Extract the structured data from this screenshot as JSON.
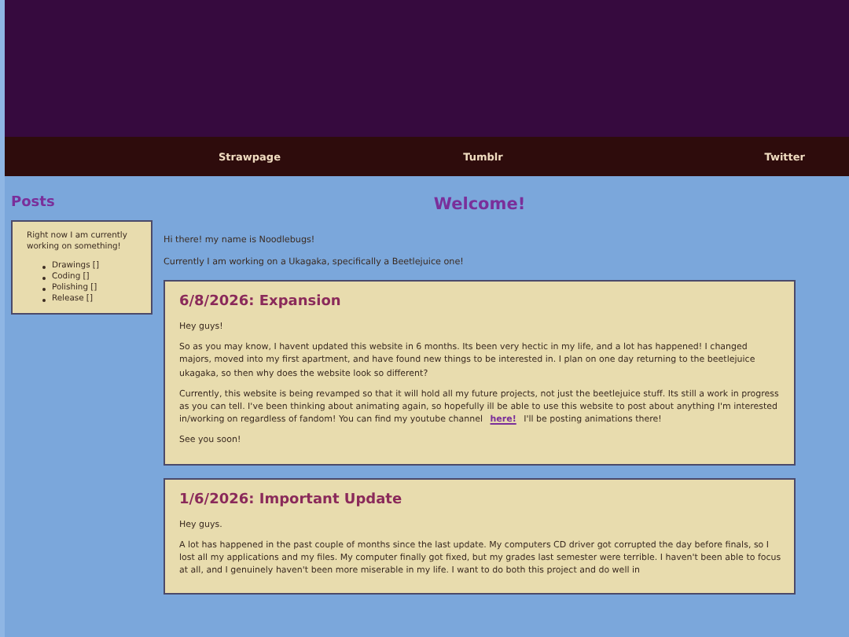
{
  "nav": {
    "links": [
      "Strawpage",
      "Tumblr",
      "Twitter"
    ]
  },
  "sidebar": {
    "title": "Posts",
    "note": "Right now I am currently working on something!",
    "items": [
      "Drawings []",
      "Coding []",
      "Polishing []",
      "Release []"
    ]
  },
  "main": {
    "title": "Welcome!",
    "intro": [
      "Hi there! my name is Noodlebugs!",
      "Currently I am working on a Ukagaka, specifically a Beetlejuice one!"
    ],
    "posts": [
      {
        "title": "6/8/2026: Expansion",
        "paragraphs": [
          {
            "text": "Hey guys!"
          },
          {
            "text": "So as you may know, I havent updated this website in 6 months. Its been very hectic in my life, and a lot has happened! I changed majors, moved into my first apartment, and have found new things to be interested in. I plan on one day returning to the beetlejuice ukagaka, so then why does the website look so different?"
          },
          {
            "text": "Currently, this website is being revamped so that it will hold all my future projects, not just the beetlejuice stuff. Its still a work in progress as you can tell. I've been thinking about animating again, so hopefully ill be able to use this website to post about anything I'm interested in/working on regardless of fandom! You can find my youtube channel ",
            "link": "here!",
            "after": " I'll be posting animations there!"
          },
          {
            "text": "See you soon!"
          }
        ]
      },
      {
        "title": "1/6/2026: Important Update",
        "paragraphs": [
          {
            "text": "Hey guys."
          },
          {
            "text": "A lot has happened in the past couple of months since the last update. My computers CD driver got corrupted the day before finals, so I lost all my applications and my files. My computer finally got fixed, but my grades last semester were terrible. I haven't been able to focus at all, and I genuinely haven't been more miserable in my life. I want to do both this project and do well in"
          }
        ]
      }
    ]
  }
}
